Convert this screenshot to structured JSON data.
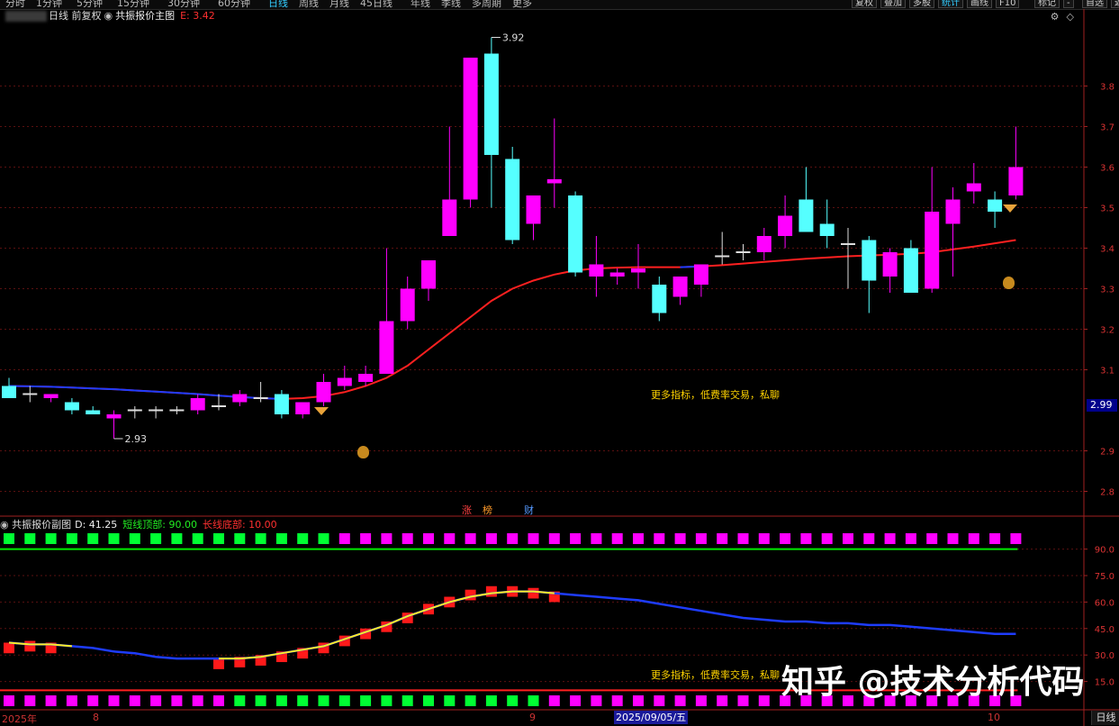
{
  "toolbar": {
    "periods": [
      "分时",
      "1分钟",
      "5分钟",
      "15分钟",
      "30分钟",
      "60分钟",
      "日线",
      "周线",
      "月线",
      "45日线",
      "年线",
      "季线",
      "多周期",
      "更多"
    ],
    "active_period": "日线",
    "right_buttons": [
      "复权",
      "叠加",
      "多股",
      "统计",
      "画线",
      "F10",
      "标记",
      "-",
      "自选",
      "返回"
    ],
    "active_right": "统计"
  },
  "main_header": {
    "title": "日线 前复权",
    "indicator": "共振报价主图",
    "eval_label": "E: 3.42"
  },
  "main_axis": [
    "3.8",
    "3.7",
    "3.6",
    "3.5",
    "3.4",
    "3.3",
    "3.2",
    "3.1",
    "2.9",
    "2.8"
  ],
  "price_tag": "2.99",
  "hi_label": "3.92",
  "lo_label": "2.93",
  "annotation_main": "更多指标，低费率交易，私聊",
  "annotation_sub": "更多指标，低费率交易，私聊",
  "tags": [
    "涨",
    "榜",
    "财"
  ],
  "sub_header": {
    "name": "共振报价副图",
    "d_label": "D: 41.25",
    "top_label": "短线顶部: 90.00",
    "bottom_label": "长线底部: 10.00"
  },
  "sub_axis": [
    "90.0",
    "75.0",
    "60.0",
    "45.0",
    "30.0",
    "15.0"
  ],
  "date_labels": [
    "2025年",
    "8",
    "9",
    "10"
  ],
  "date_highlight": "2025/09/05/五",
  "period_tag": "日线",
  "watermark": "知乎 @技术分析代码",
  "colors": {
    "up": "#ff00ff",
    "down": "#55ffff",
    "ma_red": "#ff2020",
    "ma_blue": "#1e3cff",
    "sig_green": "#00ff33",
    "line_green": "#00ee00",
    "line_red": "#ff2020"
  },
  "chart_data": {
    "type": "candlestick",
    "candles": [
      {
        "o": 3.06,
        "h": 3.08,
        "l": 3.03,
        "c": 3.03
      },
      {
        "o": 3.04,
        "h": 3.06,
        "l": 3.02,
        "c": 3.04
      },
      {
        "o": 3.03,
        "h": 3.04,
        "l": 3.02,
        "c": 3.04
      },
      {
        "o": 3.02,
        "h": 3.03,
        "l": 2.99,
        "c": 3.0
      },
      {
        "o": 3.0,
        "h": 3.01,
        "l": 2.99,
        "c": 2.99
      },
      {
        "o": 2.98,
        "h": 3.0,
        "l": 2.93,
        "c": 2.99
      },
      {
        "o": 3.0,
        "h": 3.01,
        "l": 2.98,
        "c": 3.0
      },
      {
        "o": 3.0,
        "h": 3.01,
        "l": 2.98,
        "c": 3.0
      },
      {
        "o": 3.0,
        "h": 3.01,
        "l": 2.99,
        "c": 3.0
      },
      {
        "o": 3.0,
        "h": 3.04,
        "l": 2.99,
        "c": 3.03
      },
      {
        "o": 3.01,
        "h": 3.04,
        "l": 3.0,
        "c": 3.01
      },
      {
        "o": 3.02,
        "h": 3.05,
        "l": 3.01,
        "c": 3.04
      },
      {
        "o": 3.03,
        "h": 3.07,
        "l": 3.02,
        "c": 3.03
      },
      {
        "o": 3.04,
        "h": 3.05,
        "l": 2.98,
        "c": 2.99
      },
      {
        "o": 2.99,
        "h": 3.02,
        "l": 2.98,
        "c": 3.02
      },
      {
        "o": 3.02,
        "h": 3.09,
        "l": 3.01,
        "c": 3.07
      },
      {
        "o": 3.06,
        "h": 3.11,
        "l": 3.05,
        "c": 3.08
      },
      {
        "o": 3.07,
        "h": 3.11,
        "l": 3.06,
        "c": 3.09
      },
      {
        "o": 3.09,
        "h": 3.4,
        "l": 3.09,
        "c": 3.22
      },
      {
        "o": 3.22,
        "h": 3.33,
        "l": 3.2,
        "c": 3.3
      },
      {
        "o": 3.3,
        "h": 3.37,
        "l": 3.27,
        "c": 3.37
      },
      {
        "o": 3.43,
        "h": 3.7,
        "l": 3.43,
        "c": 3.52
      },
      {
        "o": 3.52,
        "h": 3.87,
        "l": 3.5,
        "c": 3.87
      },
      {
        "o": 3.88,
        "h": 3.92,
        "l": 3.5,
        "c": 3.63
      },
      {
        "o": 3.62,
        "h": 3.65,
        "l": 3.41,
        "c": 3.42
      },
      {
        "o": 3.46,
        "h": 3.53,
        "l": 3.42,
        "c": 3.53
      },
      {
        "o": 3.56,
        "h": 3.72,
        "l": 3.5,
        "c": 3.57
      },
      {
        "o": 3.53,
        "h": 3.54,
        "l": 3.33,
        "c": 3.34
      },
      {
        "o": 3.33,
        "h": 3.43,
        "l": 3.28,
        "c": 3.36
      },
      {
        "o": 3.33,
        "h": 3.35,
        "l": 3.31,
        "c": 3.34
      },
      {
        "o": 3.34,
        "h": 3.41,
        "l": 3.3,
        "c": 3.35
      },
      {
        "o": 3.31,
        "h": 3.33,
        "l": 3.22,
        "c": 3.24
      },
      {
        "o": 3.28,
        "h": 3.32,
        "l": 3.26,
        "c": 3.33
      },
      {
        "o": 3.31,
        "h": 3.36,
        "l": 3.28,
        "c": 3.36
      },
      {
        "o": 3.38,
        "h": 3.44,
        "l": 3.36,
        "c": 3.38
      },
      {
        "o": 3.39,
        "h": 3.41,
        "l": 3.37,
        "c": 3.39
      },
      {
        "o": 3.39,
        "h": 3.45,
        "l": 3.37,
        "c": 3.43
      },
      {
        "o": 3.43,
        "h": 3.53,
        "l": 3.4,
        "c": 3.48
      },
      {
        "o": 3.52,
        "h": 3.6,
        "l": 3.44,
        "c": 3.44
      },
      {
        "o": 3.46,
        "h": 3.52,
        "l": 3.4,
        "c": 3.43
      },
      {
        "o": 3.41,
        "h": 3.45,
        "l": 3.3,
        "c": 3.41
      },
      {
        "o": 3.42,
        "h": 3.43,
        "l": 3.24,
        "c": 3.32
      },
      {
        "o": 3.33,
        "h": 3.4,
        "l": 3.29,
        "c": 3.39
      },
      {
        "o": 3.4,
        "h": 3.42,
        "l": 3.29,
        "c": 3.29
      },
      {
        "o": 3.3,
        "h": 3.6,
        "l": 3.29,
        "c": 3.49
      },
      {
        "o": 3.46,
        "h": 3.55,
        "l": 3.33,
        "c": 3.52
      },
      {
        "o": 3.54,
        "h": 3.61,
        "l": 3.51,
        "c": 3.56
      },
      {
        "o": 3.52,
        "h": 3.54,
        "l": 3.45,
        "c": 3.49
      },
      {
        "o": 3.53,
        "h": 3.7,
        "l": 3.52,
        "c": 3.6
      }
    ],
    "ma": [
      3.06,
      3.059,
      3.058,
      3.056,
      3.054,
      3.052,
      3.049,
      3.046,
      3.043,
      3.04,
      3.036,
      3.033,
      3.03,
      3.028,
      3.03,
      3.035,
      3.045,
      3.06,
      3.08,
      3.11,
      3.15,
      3.19,
      3.23,
      3.27,
      3.3,
      3.32,
      3.335,
      3.345,
      3.35,
      3.352,
      3.353,
      3.353,
      3.353,
      3.355,
      3.358,
      3.362,
      3.366,
      3.37,
      3.374,
      3.377,
      3.38,
      3.382,
      3.384,
      3.386,
      3.39,
      3.397,
      3.404,
      3.412,
      3.42
    ],
    "ma_blue_ranges": [
      [
        0,
        13
      ],
      [
        32,
        33
      ]
    ],
    "y_range": [
      2.75,
      3.95
    ],
    "sub_line": [
      37,
      36,
      36,
      35,
      34,
      32,
      31,
      29,
      28,
      28,
      28,
      28,
      29,
      31,
      33,
      35,
      39,
      43,
      47,
      52,
      56,
      60,
      63,
      65,
      66,
      66,
      65,
      64,
      63,
      62,
      61,
      59,
      57,
      55,
      53,
      51,
      50,
      49,
      49,
      48,
      48,
      47,
      47,
      46,
      45,
      44,
      43,
      42,
      42
    ],
    "sub_bars": [
      37,
      38,
      37,
      null,
      null,
      null,
      null,
      null,
      null,
      null,
      28,
      29,
      30,
      32,
      34,
      37,
      41,
      45,
      49,
      54,
      59,
      63,
      67,
      69,
      69,
      68,
      66,
      null,
      null,
      null,
      null,
      null,
      null,
      null,
      null,
      null,
      null,
      null,
      null,
      null,
      null,
      null,
      null,
      null,
      null,
      null,
      null,
      null,
      null
    ],
    "sub_line_colors": {
      "blue_from": 27,
      "yellow_segments": [
        [
          0,
          3
        ],
        [
          10,
          26
        ]
      ]
    },
    "sub_y_range": [
      0,
      100
    ],
    "top_signals": [
      "g",
      "g",
      "g",
      "g",
      "g",
      "g",
      "g",
      "g",
      "g",
      "g",
      "g",
      "g",
      "g",
      "g",
      "g",
      "g",
      "m",
      "m",
      "m",
      "m",
      "m",
      "m",
      "m",
      "m",
      "m",
      "m",
      "m",
      "m",
      "m",
      "m",
      "m",
      "m",
      "m",
      "m",
      "m",
      "m",
      "m",
      "m",
      "m",
      "m",
      "m",
      "m",
      "m",
      "m",
      "m",
      "m",
      "m",
      "m",
      "m"
    ],
    "bottom_signals": [
      "m",
      "m",
      "m",
      "m",
      "m",
      "m",
      "m",
      "m",
      "m",
      "m",
      "m",
      "g",
      "g",
      "g",
      "g",
      "g",
      "g",
      "g",
      "g",
      "g",
      "g",
      "g",
      "g",
      "g",
      "g",
      "g",
      "m",
      "m",
      "m",
      "m",
      "m",
      "m",
      "m",
      "m",
      "m",
      "m",
      "m",
      "m",
      "m",
      "m",
      "m",
      "m",
      "m",
      "m",
      "m",
      "m",
      "m",
      "m",
      "m"
    ]
  }
}
